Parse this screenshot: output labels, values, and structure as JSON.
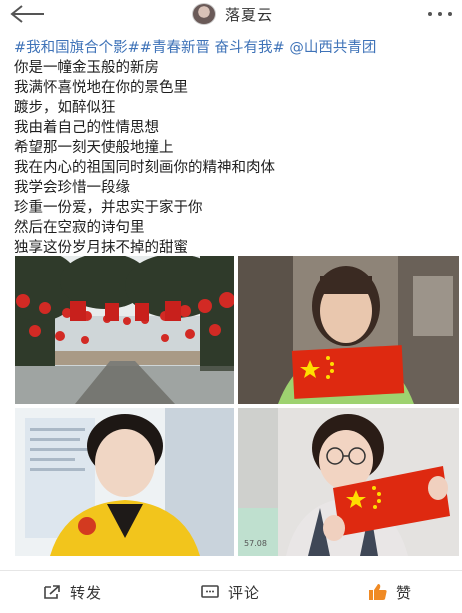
{
  "header": {
    "username": "落夏云",
    "back_icon": "back-arrow-icon",
    "more_icon": "more-dots-icon"
  },
  "post": {
    "topic_line": "#我和国旗合个影##青春新晋 奋斗有我# @山西共青团",
    "lines": [
      "你是一幢金玉般的新房",
      "我满怀喜悦地在你的景色里",
      "踱步，如醉似狂",
      "我由着自己的性情思想",
      "希望那一刻天使般地撞上",
      "我在内心的祖国同时刻画你的精神和肉体",
      "我学会珍惜一段缘",
      "珍重一份爱，并忠实于家于你",
      "然后在空寂的诗句里",
      "独享这份岁月抹不掉的甜蜜"
    ]
  },
  "photos": [
    {
      "subject": "campus road with red lanterns and trees"
    },
    {
      "subject": "girl holding Chinese flag indoors"
    },
    {
      "subject": "girl in yellow volunteer vest"
    },
    {
      "subject": "girl with glasses holding Chinese flag"
    }
  ],
  "watermarks": {
    "photo4": "57.08"
  },
  "actions": {
    "share": {
      "label": "转发",
      "icon": "share-icon"
    },
    "comment": {
      "label": "评论",
      "icon": "comment-icon"
    },
    "like": {
      "label": "赞",
      "icon": "thumbs-up-icon"
    }
  },
  "colors": {
    "topic_blue": "#3f73b8",
    "like_orange": "#f08a24",
    "flag_red": "#de2910",
    "flag_yellow": "#ffde00"
  }
}
